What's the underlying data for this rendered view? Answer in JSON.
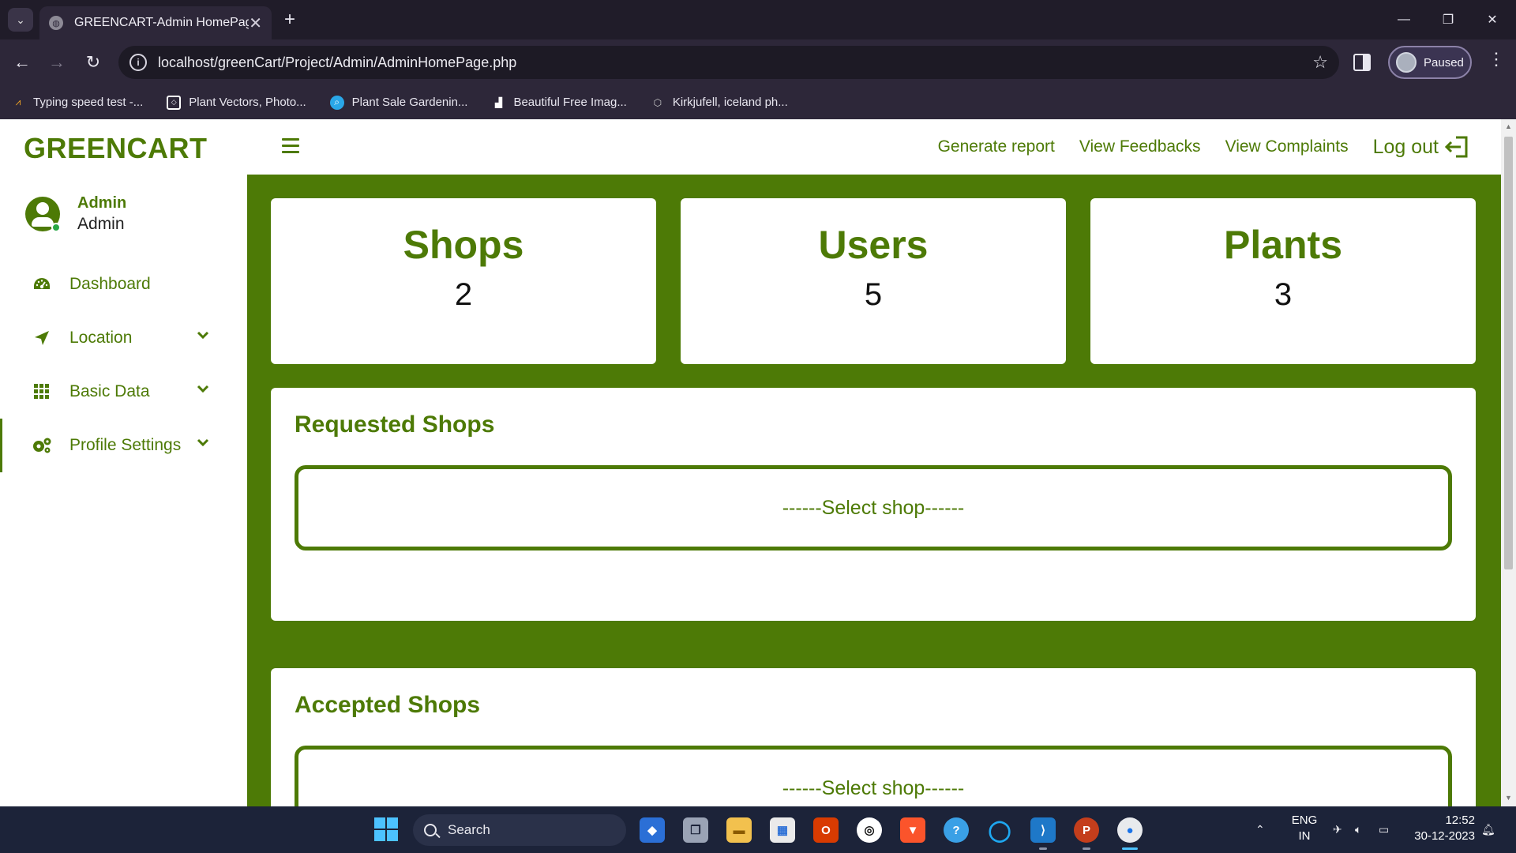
{
  "browser": {
    "tab_title": "GREENCART-Admin HomePage",
    "url": "localhost/greenCart/Project/Admin/AdminHomePage.php",
    "profile_status": "Paused",
    "bookmarks": [
      {
        "label": "Typing speed test -...",
        "icon": "typing-test-icon"
      },
      {
        "label": "Plant Vectors, Photo...",
        "icon": "codepen-icon"
      },
      {
        "label": "Plant Sale Gardenin...",
        "icon": "search-icon"
      },
      {
        "label": "Beautiful Free Imag...",
        "icon": "unsplash-icon"
      },
      {
        "label": "Kirkjufell, iceland ph...",
        "icon": "cube-icon"
      }
    ]
  },
  "sidebar": {
    "brand": "GREENCART",
    "user_name": "Admin",
    "user_role": "Admin",
    "items": [
      {
        "label": "Dashboard",
        "icon": "dashboard-gauge-icon"
      },
      {
        "label": "Location",
        "icon": "location-arrow-icon"
      },
      {
        "label": "Basic Data",
        "icon": "grid-icon"
      },
      {
        "label": "Profile Settings",
        "icon": "gears-icon"
      }
    ]
  },
  "topnav": {
    "links": [
      "Generate report",
      "View Feedbacks",
      "View Complaints"
    ],
    "logout": "Log out"
  },
  "stats": [
    {
      "title": "Shops",
      "value": "2"
    },
    {
      "title": "Users",
      "value": "5"
    },
    {
      "title": "Plants",
      "value": "3"
    }
  ],
  "panels": {
    "requested": {
      "title": "Requested Shops",
      "select": "------Select shop------"
    },
    "accepted": {
      "title": "Accepted Shops",
      "select": "------Select shop------"
    }
  },
  "taskbar": {
    "search_label": "Search",
    "lang_line1": "ENG",
    "lang_line2": "IN",
    "time": "12:52",
    "date": "30-12-2023"
  },
  "colors": {
    "brand_green": "#4d7a06",
    "browser_frame": "#2d2739",
    "taskbar": "#1c2339"
  }
}
